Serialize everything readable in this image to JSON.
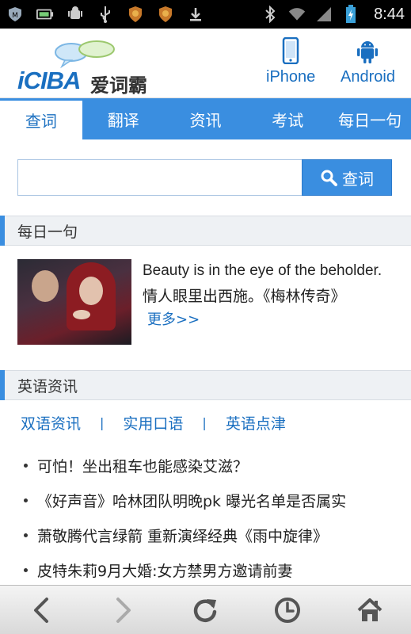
{
  "status_bar": {
    "time": "8:44"
  },
  "header": {
    "logo_text": "iCIBA",
    "logo_cn": "爱词霸",
    "platforms": [
      {
        "label": "iPhone",
        "icon": "phone-icon"
      },
      {
        "label": "Android",
        "icon": "android-icon"
      }
    ]
  },
  "tabs": [
    {
      "label": "查词",
      "active": true
    },
    {
      "label": "翻译"
    },
    {
      "label": "资讯"
    },
    {
      "label": "考试"
    },
    {
      "label": "每日一句"
    }
  ],
  "search": {
    "value": "",
    "button_label": "查词"
  },
  "daily": {
    "section_title": "每日一句",
    "english": "Beauty is in the eye of the beholder.",
    "chinese": "情人眼里出西施。《梅林传奇》",
    "more": "更多>>"
  },
  "news": {
    "section_title": "英语资讯",
    "links": [
      "双语资讯",
      "实用口语",
      "英语点津"
    ],
    "separator": "|",
    "items": [
      "可怕！坐出租车也能感染艾滋？",
      "《好声音》哈林团队明晚pk 曝光名单是否属实",
      "萧敬腾代言绿箭 重新演绎经典《雨中旋律》",
      "皮特朱莉9月大婚:女方禁男方邀请前妻"
    ]
  },
  "colors": {
    "accent": "#3a8ee0",
    "link": "#1a6fc0"
  }
}
